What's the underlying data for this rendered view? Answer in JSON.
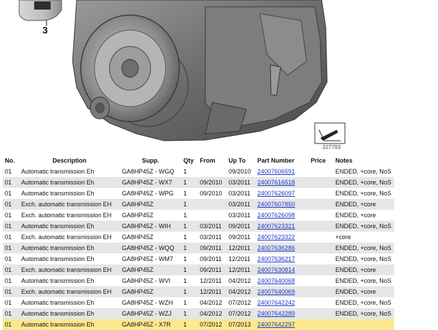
{
  "illustration": {
    "reference_number": "3",
    "image_id": "327793"
  },
  "table": {
    "headers": {
      "no": "No.",
      "description": "Description",
      "supp": "Supp.",
      "qty": "Qty",
      "from": "From",
      "upto": "Up To",
      "part_number": "Part Number",
      "price": "Price",
      "notes": "Notes"
    },
    "rows": [
      {
        "no": "01",
        "description": "Automatic transmission Eh",
        "supp": "GA8HP45Z - WGQ",
        "qty": "1",
        "from": "",
        "upto": "09/2010",
        "part_number": "24007606591",
        "price": "",
        "notes": "ENDED, +core, NoS"
      },
      {
        "no": "01",
        "description": "Automatic transmission Eh",
        "supp": "GA8HP45Z - WX7",
        "qty": "1",
        "from": "09/2010",
        "upto": "03/2011",
        "part_number": "24007616518",
        "price": "",
        "notes": "ENDED, +core, NoS"
      },
      {
        "no": "01",
        "description": "Automatic transmission Eh",
        "supp": "GA8HP45Z - WPG",
        "qty": "1",
        "from": "09/2010",
        "upto": "03/2011",
        "part_number": "24007626097",
        "price": "",
        "notes": "ENDED, +core, NoS"
      },
      {
        "no": "01",
        "description": "Exch. automatic transmission EH",
        "supp": "GA8HP45Z",
        "qty": "1",
        "from": "",
        "upto": "03/2011",
        "part_number": "24007607850",
        "price": "",
        "notes": "ENDED, +core"
      },
      {
        "no": "01",
        "description": "Exch. automatic transmission EH",
        "supp": "GA8HP45Z",
        "qty": "1",
        "from": "",
        "upto": "03/2011",
        "part_number": "24007626098",
        "price": "",
        "notes": "ENDED, +core"
      },
      {
        "no": "01",
        "description": "Automatic transmission Eh",
        "supp": "GA8HP45Z - WIH",
        "qty": "1",
        "from": "03/2011",
        "upto": "09/2011",
        "part_number": "24007623321",
        "price": "",
        "notes": "ENDED, +core, NoS"
      },
      {
        "no": "01",
        "description": "Exch. automatic transmission EH",
        "supp": "GA8HP45Z",
        "qty": "1",
        "from": "03/2011",
        "upto": "09/2011",
        "part_number": "24007623322",
        "price": "",
        "notes": "+core"
      },
      {
        "no": "01",
        "description": "Automatic transmission Eh",
        "supp": "GA8HP45Z - WQQ",
        "qty": "1",
        "from": "09/2011",
        "upto": "12/2011",
        "part_number": "24007636286",
        "price": "",
        "notes": "ENDED, +core, NoS"
      },
      {
        "no": "01",
        "description": "Automatic transmission Eh",
        "supp": "GA8HP45Z - WM7",
        "qty": "1",
        "from": "09/2011",
        "upto": "12/2011",
        "part_number": "24007636217",
        "price": "",
        "notes": "ENDED, +core, NoS"
      },
      {
        "no": "01",
        "description": "Exch. automatic transmission EH",
        "supp": "GA8HP45Z",
        "qty": "1",
        "from": "09/2011",
        "upto": "12/2011",
        "part_number": "24007630814",
        "price": "",
        "notes": "ENDED, +core"
      },
      {
        "no": "01",
        "description": "Automatic transmission Eh",
        "supp": "GA8HP45Z - WVI",
        "qty": "1",
        "from": "12/2011",
        "upto": "04/2012",
        "part_number": "24007640068",
        "price": "",
        "notes": "ENDED, +core, NoS"
      },
      {
        "no": "01",
        "description": "Exch. automatic transmission EH",
        "supp": "GA8HP45Z",
        "qty": "1",
        "from": "12/2011",
        "upto": "04/2012",
        "part_number": "24007640069",
        "price": "",
        "notes": "ENDED, +core"
      },
      {
        "no": "01",
        "description": "Automatic transmission Eh",
        "supp": "GA8HP45Z - WZH",
        "qty": "1",
        "from": "04/2012",
        "upto": "07/2012",
        "part_number": "24007642242",
        "price": "",
        "notes": "ENDED, +core, NoS"
      },
      {
        "no": "01",
        "description": "Automatic transmission Eh",
        "supp": "GA8HP45Z - WZJ",
        "qty": "1",
        "from": "04/2012",
        "upto": "07/2012",
        "part_number": "24007642289",
        "price": "",
        "notes": "ENDED, +core, NoS"
      },
      {
        "no": "01",
        "description": "Automatic transmission Eh",
        "supp": "GA8HP45Z - X7R",
        "qty": "1",
        "from": "07/2012",
        "upto": "07/2013",
        "part_number": "24007642297",
        "price": "",
        "notes": "",
        "highlight": true
      }
    ]
  }
}
